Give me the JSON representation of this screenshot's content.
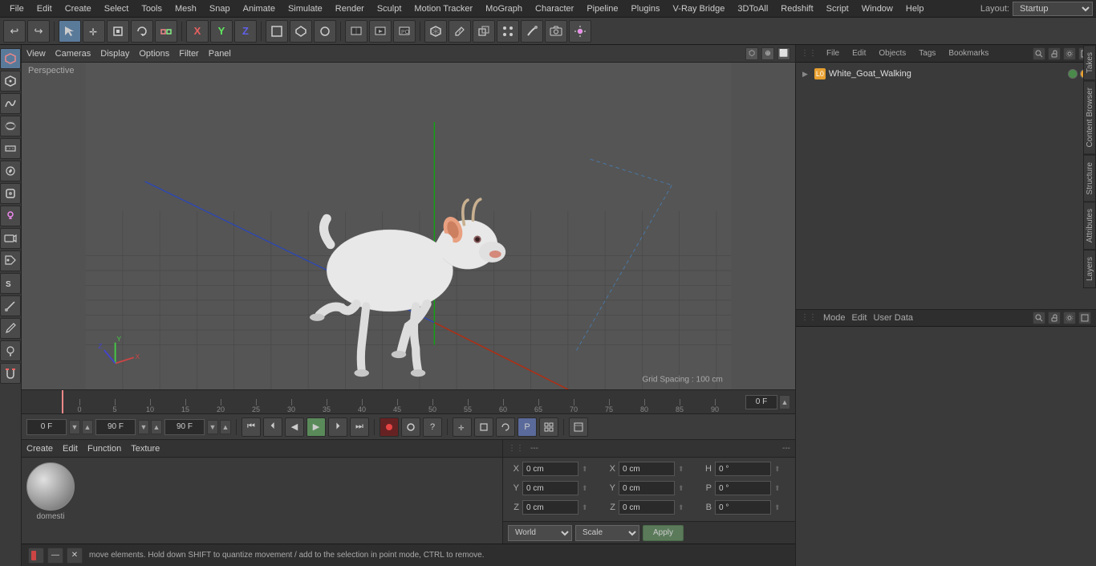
{
  "menubar": {
    "items": [
      "File",
      "Edit",
      "Create",
      "Select",
      "Tools",
      "Mesh",
      "Snap",
      "Animate",
      "Simulate",
      "Render",
      "Sculpt",
      "Motion Tracker",
      "MoGraph",
      "Character",
      "Pipeline",
      "Plugins",
      "V-Ray Bridge",
      "3DToAll",
      "Redshift",
      "Script",
      "Window",
      "Help"
    ],
    "layout_label": "Layout:",
    "layout_value": "Startup"
  },
  "toolbar": {
    "undo_icon": "↩",
    "redo_icon": "↪",
    "select_icon": "↖",
    "move_icon": "✛",
    "scale_icon": "⬛",
    "rotate_icon": "↺",
    "x_icon": "X",
    "y_icon": "Y",
    "z_icon": "Z",
    "mode_icon": "◻"
  },
  "viewport": {
    "menu_items": [
      "View",
      "Cameras",
      "Display",
      "Options",
      "Filter",
      "Panel"
    ],
    "perspective_label": "Perspective",
    "grid_spacing": "Grid Spacing : 100 cm"
  },
  "timeline": {
    "marks": [
      "0",
      "5",
      "10",
      "15",
      "20",
      "25",
      "30",
      "35",
      "40",
      "45",
      "50",
      "55",
      "60",
      "65",
      "70",
      "75",
      "80",
      "85",
      "90"
    ],
    "current_frame": "0 F",
    "start_frame": "0 F",
    "end_frame": "90 F",
    "preview_end": "90 F"
  },
  "transport": {
    "start_frame_label": "0 F",
    "start_frame2_label": "0 F",
    "end_frame_label": "90 F",
    "end_frame2_label": "90 F",
    "current_frame_label": "0 F"
  },
  "material_panel": {
    "menu_items": [
      "Create",
      "Edit",
      "Function",
      "Texture"
    ],
    "material_name": "domesti"
  },
  "objects_panel": {
    "header_items": [
      "File",
      "Edit",
      "Objects",
      "Tags",
      "Bookmarks"
    ],
    "object_name": "White_Goat_Walking"
  },
  "coord_panel": {
    "header_items": [
      "Mode",
      "Edit",
      "User Data"
    ],
    "x_pos": "0 cm",
    "y_pos": "0 cm",
    "z_pos": "0 cm",
    "x_size": "0 cm",
    "y_size": "0 cm",
    "z_size": "0 cm",
    "h_rot": "0 °",
    "p_rot": "0 °",
    "b_rot": "0 °",
    "world_label": "World",
    "scale_label": "Scale",
    "apply_label": "Apply"
  },
  "status_bar": {
    "text": "move elements. Hold down SHIFT to quantize movement / add to the selection in point mode, CTRL to remove."
  },
  "side_tabs": [
    "Takes",
    "Content Browser",
    "Structure",
    "Attributes",
    "Layers"
  ]
}
